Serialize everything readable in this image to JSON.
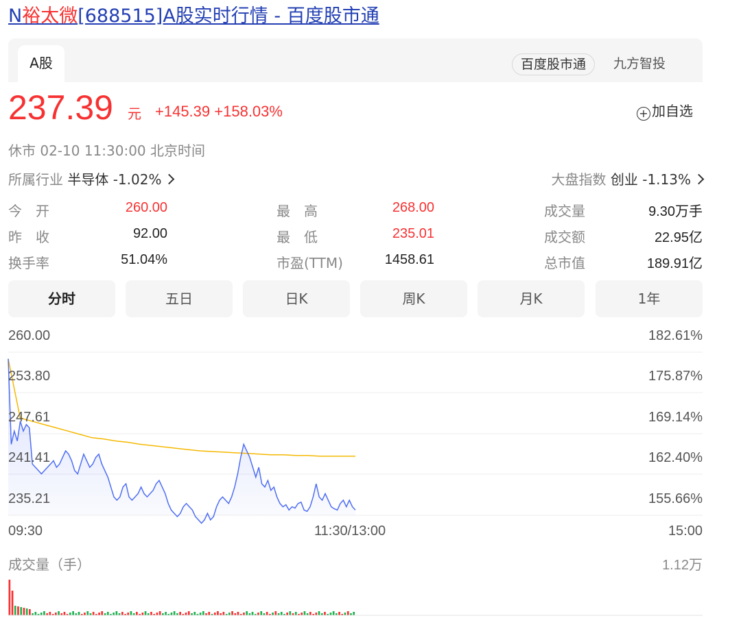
{
  "title": {
    "prefix": "N",
    "highlight": "裕太微",
    "rest": "[688515]A股实时行情 - 百度股市通"
  },
  "tabs": {
    "market": "A股"
  },
  "sources": {
    "active": "百度股市通",
    "other": "九方智投"
  },
  "quote": {
    "price": "237.39",
    "unit": "元",
    "change": "+145.39",
    "change_pct": "+158.03%",
    "add_watch": "加自选",
    "add_icon": "+",
    "status": "休市",
    "time": "02-10 11:30:00",
    "tz": "北京时间",
    "industry_label": "所属行业",
    "industry_name": "半导体",
    "industry_pct": "-1.02%",
    "index_label": "大盘指数",
    "index_name": "创业",
    "index_pct": "-1.13%"
  },
  "stats": {
    "open_l": "今　开",
    "open_v": "260.00",
    "prev_l": "昨　收",
    "prev_v": "92.00",
    "turn_l": "换手率",
    "turn_v": "51.04%",
    "high_l": "最　高",
    "high_v": "268.00",
    "low_l": "最　低",
    "low_v": "235.01",
    "pe_l": "市盈(TTM)",
    "pe_v": "1458.61",
    "vol_l": "成交量",
    "vol_v": "9.30万手",
    "amt_l": "成交额",
    "amt_v": "22.95亿",
    "cap_l": "总市值",
    "cap_v": "189.91亿"
  },
  "period_tabs": [
    "分时",
    "五日",
    "日K",
    "周K",
    "月K",
    "1年"
  ],
  "chart": {
    "y_left": [
      "260.00",
      "253.80",
      "247.61",
      "241.41",
      "235.21"
    ],
    "y_right": [
      "182.61%",
      "175.87%",
      "169.14%",
      "162.40%",
      "155.66%"
    ],
    "x_labels": [
      "09:30",
      "11:30/13:00",
      "15:00"
    ],
    "vol_title": "成交量（手）",
    "vol_max": "1.12万",
    "colors": {
      "price": "#4e6ef2",
      "avg": "#f5b800",
      "up": "#f73131",
      "down": "#1db14f"
    }
  },
  "chart_data": {
    "type": "line",
    "ylim": [
      235.21,
      260.0
    ],
    "x_range": [
      0,
      240
    ],
    "series": [
      {
        "values": [
          259.0,
          246.0,
          248.0,
          246.5,
          249.5,
          248.0,
          249.0,
          248.5,
          243.0,
          242.5,
          242.0,
          241.5,
          242.0,
          242.5,
          243.0,
          243.5,
          242.5,
          243.0,
          244.0,
          245.0,
          244.5,
          243.5,
          242.0,
          241.5,
          243.0,
          244.5,
          243.5,
          242.5,
          243.0,
          244.0,
          244.5,
          243.0,
          242.0,
          241.0,
          239.5,
          238.0,
          237.5,
          238.0,
          239.5,
          240.0,
          238.0,
          237.5,
          238.0,
          238.5,
          239.5,
          238.5,
          238.0,
          238.5,
          239.0,
          240.0,
          240.5,
          239.5,
          238.5,
          237.0,
          236.0,
          235.5,
          235.0,
          235.5,
          236.5,
          237.0,
          236.5,
          236.0,
          235.0,
          234.5,
          234.0,
          234.5,
          235.5,
          234.5,
          235.0,
          236.5,
          237.5,
          238.0,
          237.5,
          237.0,
          238.0,
          239.5,
          241.5,
          244.0,
          246.0,
          245.0,
          244.0,
          242.5,
          241.0,
          242.5,
          240.0,
          239.5,
          240.5,
          239.0,
          239.5,
          238.0,
          237.0,
          236.5,
          236.8,
          236.0,
          236.5,
          236.3,
          237.0,
          237.2,
          236.0,
          235.8,
          236.5,
          238.0,
          240.0,
          238.0,
          237.5,
          238.5,
          237.5,
          236.5,
          236.2,
          236.0,
          237.0,
          237.5,
          236.5,
          237.5,
          236.5,
          236.0
        ]
      },
      {
        "values": [
          259.0,
          250.0,
          249.5,
          249.0,
          248.5,
          248.0,
          247.5,
          247.0,
          246.8,
          246.5,
          246.3,
          246.0,
          245.8,
          245.6,
          245.4,
          245.2,
          245.0,
          244.9,
          244.8,
          244.7,
          244.6,
          244.5,
          244.4,
          244.4,
          244.3,
          244.3,
          244.2,
          244.2,
          244.2,
          244.2
        ]
      }
    ]
  }
}
